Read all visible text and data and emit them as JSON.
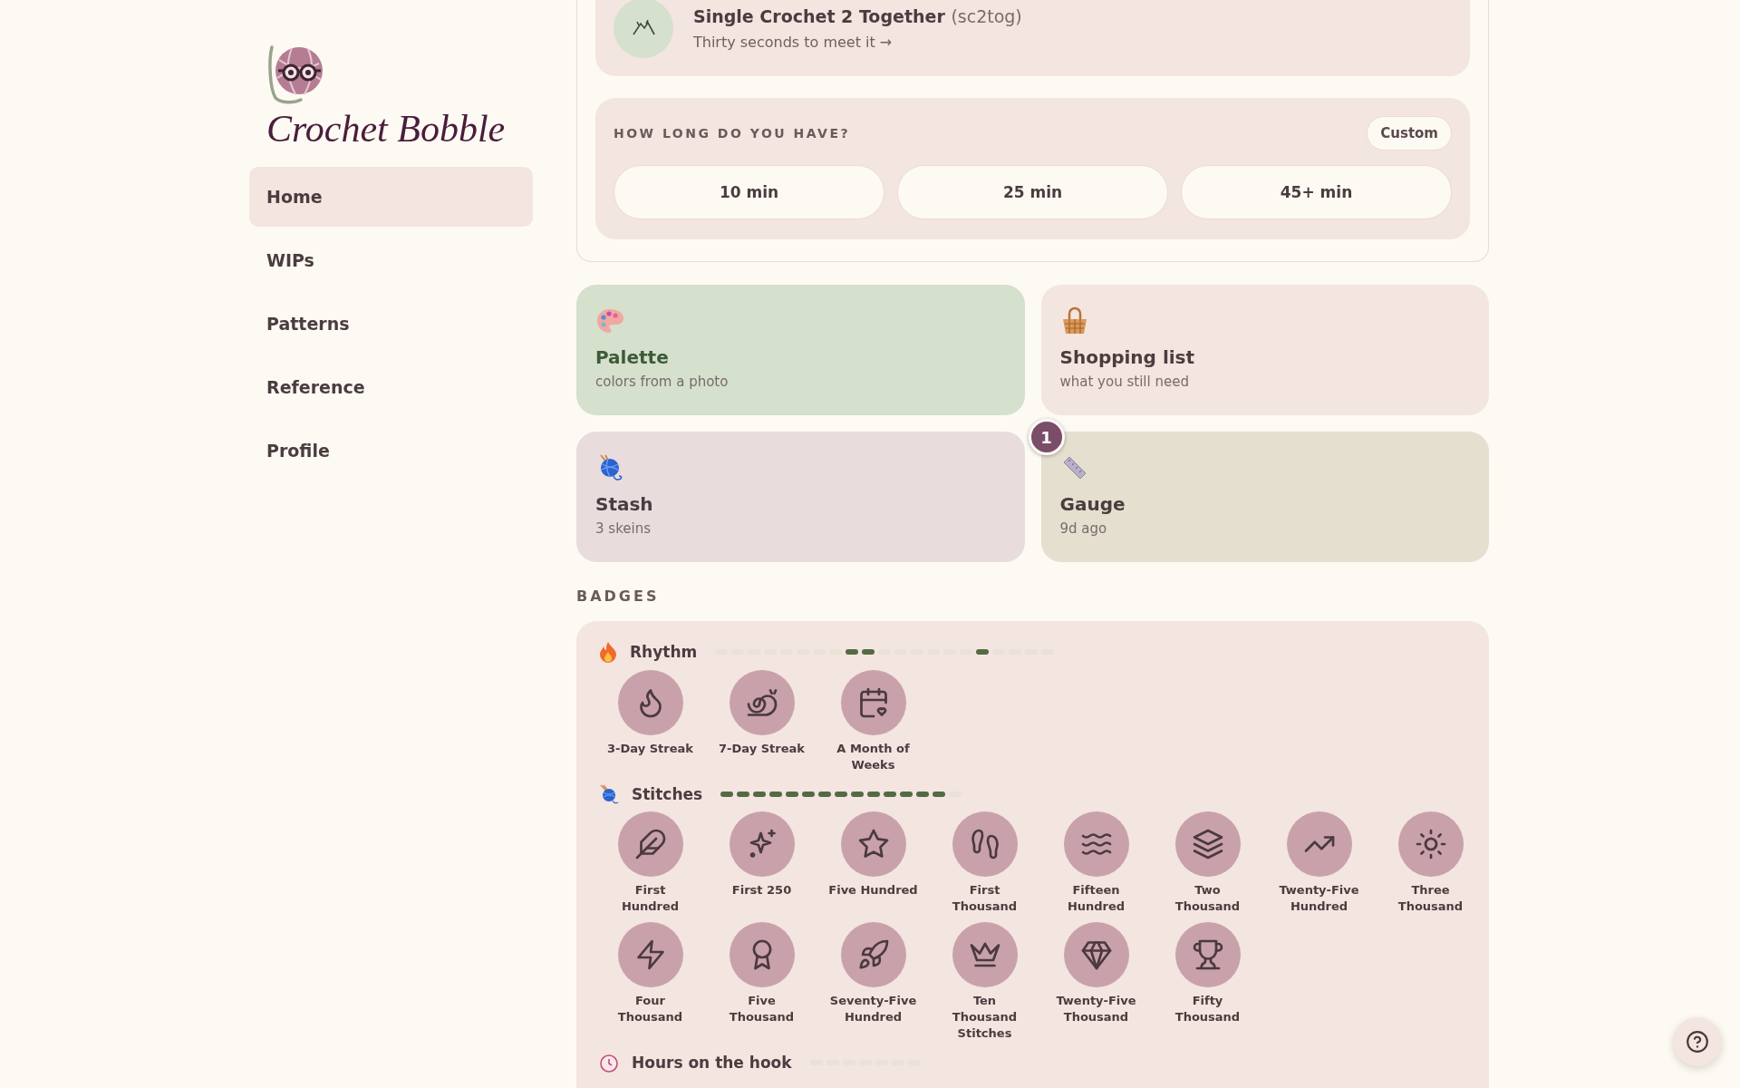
{
  "sidebar": {
    "brand": "Crochet Bobble",
    "nav": [
      {
        "label": "Home",
        "selected": true
      },
      {
        "label": "WIPs",
        "selected": false
      },
      {
        "label": "Patterns",
        "selected": false
      },
      {
        "label": "Reference",
        "selected": false
      },
      {
        "label": "Profile",
        "selected": false
      }
    ]
  },
  "featured": {
    "title": "Single Crochet 2 Together",
    "abbr": "(sc2tog)",
    "link": "Thirty seconds to meet it →"
  },
  "duration": {
    "heading": "HOW LONG DO YOU HAVE?",
    "custom": "Custom",
    "options": [
      "10 min",
      "25 min",
      "45+ min"
    ]
  },
  "tiles": [
    {
      "kind": "palette",
      "title": "Palette",
      "subtitle": "colors from a photo"
    },
    {
      "kind": "shopping",
      "title": "Shopping list",
      "subtitle": "what you still need"
    },
    {
      "kind": "stash",
      "title": "Stash",
      "subtitle": "3 skeins"
    },
    {
      "kind": "gauge",
      "title": "Gauge",
      "subtitle": "9d ago",
      "count": "1"
    }
  ],
  "badges": {
    "heading": "BADGES",
    "groups": [
      {
        "kind": "rhythm",
        "name": "Rhythm",
        "segments": [
          {
            "on": false
          },
          {
            "on": false
          },
          {
            "on": false
          },
          {
            "on": false
          },
          {
            "on": false
          },
          {
            "on": false
          },
          {
            "on": false
          },
          {
            "on": false
          },
          {
            "on": true
          },
          {
            "on": true
          },
          {
            "on": false
          },
          {
            "on": false
          },
          {
            "on": false
          },
          {
            "on": false
          },
          {
            "on": false
          },
          {
            "on": false
          },
          {
            "on": true
          },
          {
            "on": false
          },
          {
            "on": false
          },
          {
            "on": false
          },
          {
            "on": false
          }
        ],
        "items": [
          "3-Day Streak",
          "7-Day Streak",
          "A Month of Weeks"
        ]
      },
      {
        "kind": "stitches",
        "name": "Stitches",
        "segments": [
          {
            "on": true
          },
          {
            "on": true
          },
          {
            "on": true
          },
          {
            "on": true
          },
          {
            "on": true
          },
          {
            "on": true
          },
          {
            "on": true
          },
          {
            "on": true
          },
          {
            "on": true
          },
          {
            "on": true
          },
          {
            "on": true
          },
          {
            "on": true
          },
          {
            "on": true
          },
          {
            "on": true
          },
          {
            "on": false
          }
        ],
        "items": [
          "First Hundred",
          "First 250",
          "Five Hundred",
          "First Thousand",
          "Fifteen Hundred",
          "Two Thousand",
          "Twenty-Five Hundred",
          "Three Thousand",
          "Four Thousand",
          "Five Thousand",
          "Seventy-Five Hundred",
          "Ten Thousand Stitches",
          "Twenty-Five Thousand",
          "Fifty Thousand"
        ]
      },
      {
        "kind": "hours",
        "name": "Hours on the hook",
        "segments": [
          {
            "on": false
          },
          {
            "on": false
          },
          {
            "on": false
          },
          {
            "on": false
          },
          {
            "on": false
          },
          {
            "on": false
          },
          {
            "on": false
          }
        ]
      }
    ]
  }
}
